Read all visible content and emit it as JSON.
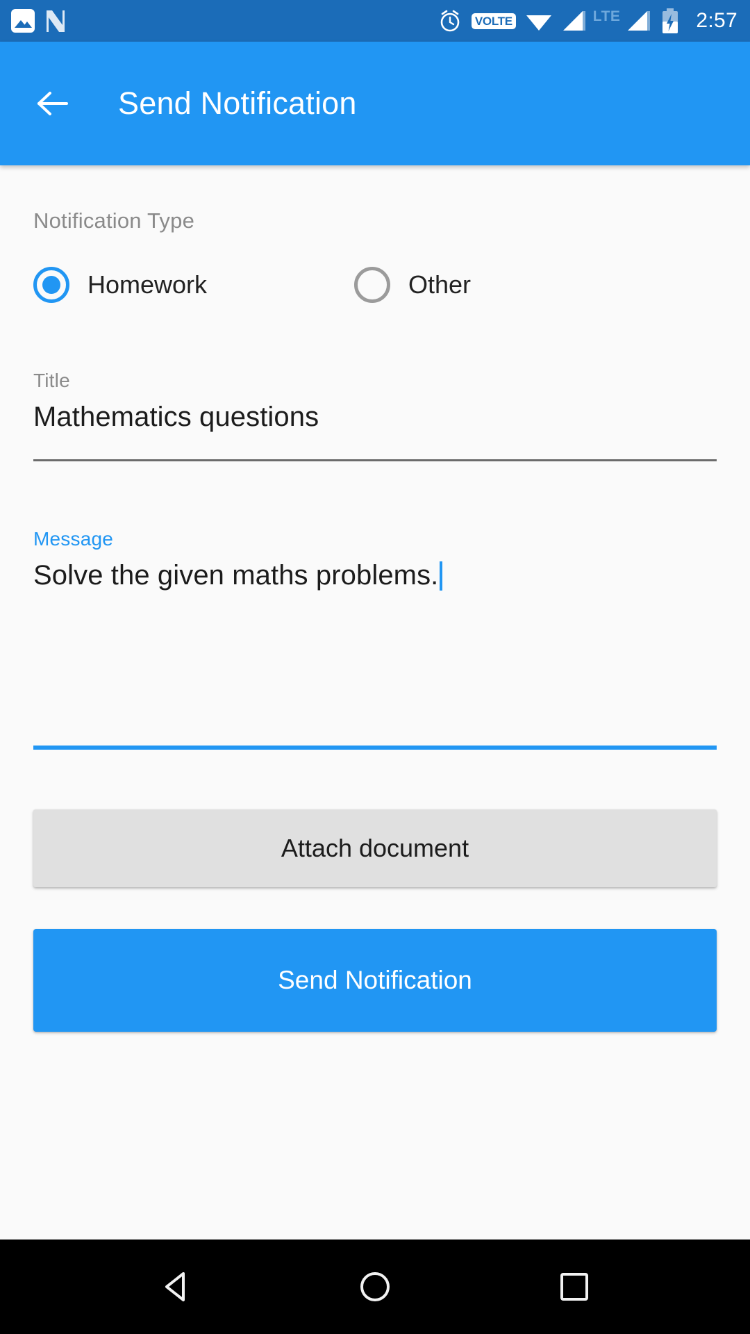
{
  "statusbar": {
    "icons_left": [
      "photo-icon",
      "android-n-icon"
    ],
    "icons_right": [
      "alarm-icon",
      "volte-badge",
      "wifi-icon",
      "signal-icon",
      "lte-label",
      "signal2-icon",
      "battery-charging-icon"
    ],
    "volte_label": "VOLTE",
    "network_label": "LTE",
    "clock": "2:57"
  },
  "appbar": {
    "back_icon": "arrow-left-icon",
    "title": "Send Notification"
  },
  "form": {
    "type_section_label": "Notification Type",
    "radio_options": [
      {
        "label": "Homework",
        "selected": true
      },
      {
        "label": "Other",
        "selected": false
      }
    ],
    "title_field": {
      "label": "Title",
      "value": "Mathematics questions",
      "placeholder": "Title",
      "focused": false
    },
    "message_field": {
      "label": "Message",
      "value": "Solve the given maths problems.",
      "placeholder": "Message",
      "focused": true
    },
    "attach_button_label": "Attach document",
    "send_button_label": "Send Notification"
  },
  "navbar": {
    "back_label": "back-triangle-icon",
    "home_label": "home-circle-icon",
    "recents_label": "recents-square-icon"
  },
  "colors": {
    "statusbar": "#1b6cb8",
    "primary": "#2196f3",
    "background": "#fafafa",
    "attach_button": "#e0e0e0",
    "label_grey": "#8a8a8a",
    "text_dark": "#1c1c1c"
  }
}
